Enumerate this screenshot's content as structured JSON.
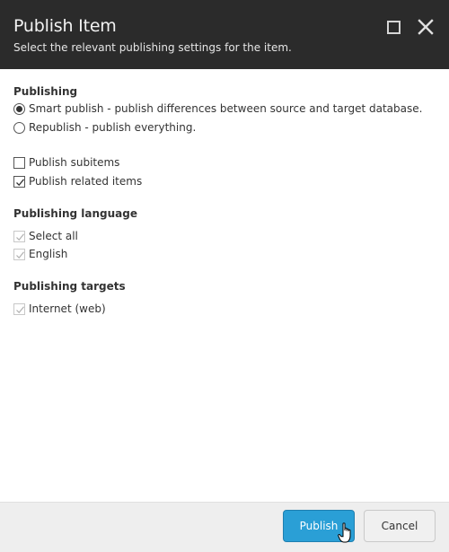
{
  "dialog": {
    "title": "Publish Item",
    "subtitle": "Select the relevant publishing settings for the item.",
    "icons": {
      "maximize": "maximize-icon",
      "close": "close-icon"
    }
  },
  "publishing": {
    "title": "Publishing",
    "modes": [
      {
        "label": "Smart publish - publish differences between source and target database.",
        "checked": true
      },
      {
        "label": "Republish - publish everything.",
        "checked": false
      }
    ],
    "options": [
      {
        "label": "Publish subitems",
        "checked": false
      },
      {
        "label": "Publish related items",
        "checked": true
      }
    ]
  },
  "language": {
    "title": "Publishing language",
    "items": [
      {
        "label": "Select all",
        "checked": true,
        "disabled": true
      },
      {
        "label": "English",
        "checked": true,
        "disabled": true
      }
    ]
  },
  "targets": {
    "title": "Publishing targets",
    "items": [
      {
        "label": "Internet (web)",
        "checked": true,
        "disabled": true
      }
    ]
  },
  "footer": {
    "publish_label": "Publish",
    "cancel_label": "Cancel",
    "accent_color": "#2a9fd6"
  }
}
